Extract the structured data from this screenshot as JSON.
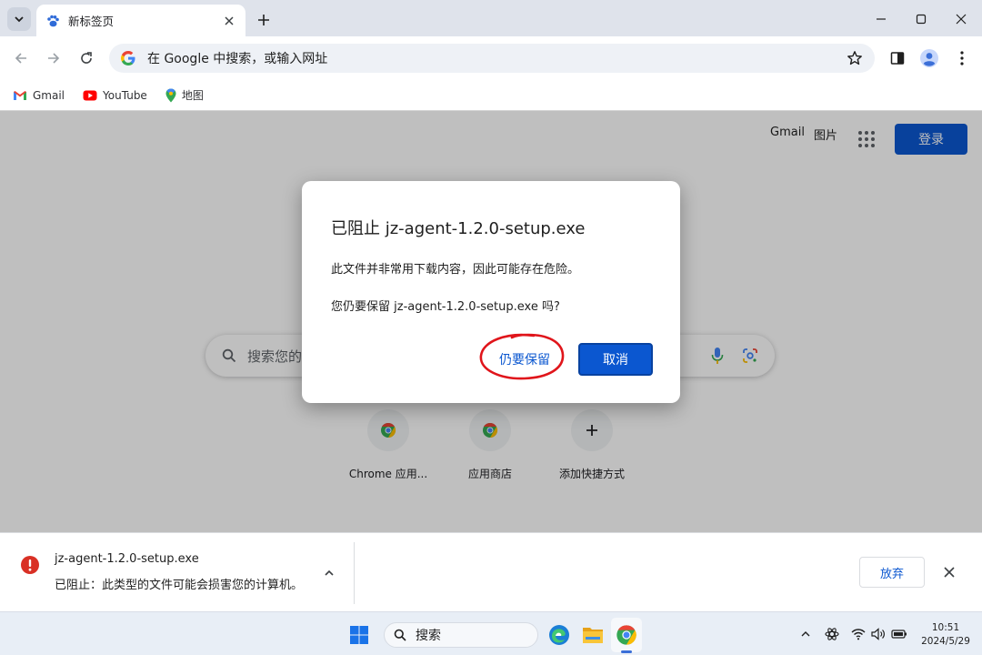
{
  "browser": {
    "tab_title": "新标签页",
    "omnibox_placeholder": "在 Google 中搜索，或输入网址",
    "bookmarks": [
      {
        "label": "Gmail",
        "icon": "gmail-icon"
      },
      {
        "label": "YouTube",
        "icon": "youtube-icon"
      },
      {
        "label": "地图",
        "icon": "maps-icon"
      }
    ]
  },
  "newtab": {
    "top_links": {
      "gmail": "Gmail",
      "images": "图片"
    },
    "sign_in": "登录",
    "search_placeholder": "搜索您的",
    "shortcuts": [
      {
        "label": "Chrome 应用...",
        "icon": "chrome-icon"
      },
      {
        "label": "应用商店",
        "icon": "chrome-icon"
      },
      {
        "label": "添加快捷方式",
        "icon": "plus-icon"
      }
    ]
  },
  "dialog": {
    "title": "已阻止 jz-agent-1.2.0-setup.exe",
    "body": "此文件并非常用下载内容，因此可能存在危险。",
    "question": "您仍要保留 jz-agent-1.2.0-setup.exe 吗?",
    "keep_label": "仍要保留",
    "cancel_label": "取消"
  },
  "download": {
    "filename": "jz-agent-1.2.0-setup.exe",
    "status": "已阻止：此类型的文件可能会损害您的计算机。",
    "discard_label": "放弃"
  },
  "taskbar": {
    "search_label": "搜索",
    "time": "10:51",
    "date": "2024/5/29"
  },
  "colors": {
    "accent": "#0b57d0",
    "warning": "#d93025",
    "annotation": "#e0151b"
  }
}
